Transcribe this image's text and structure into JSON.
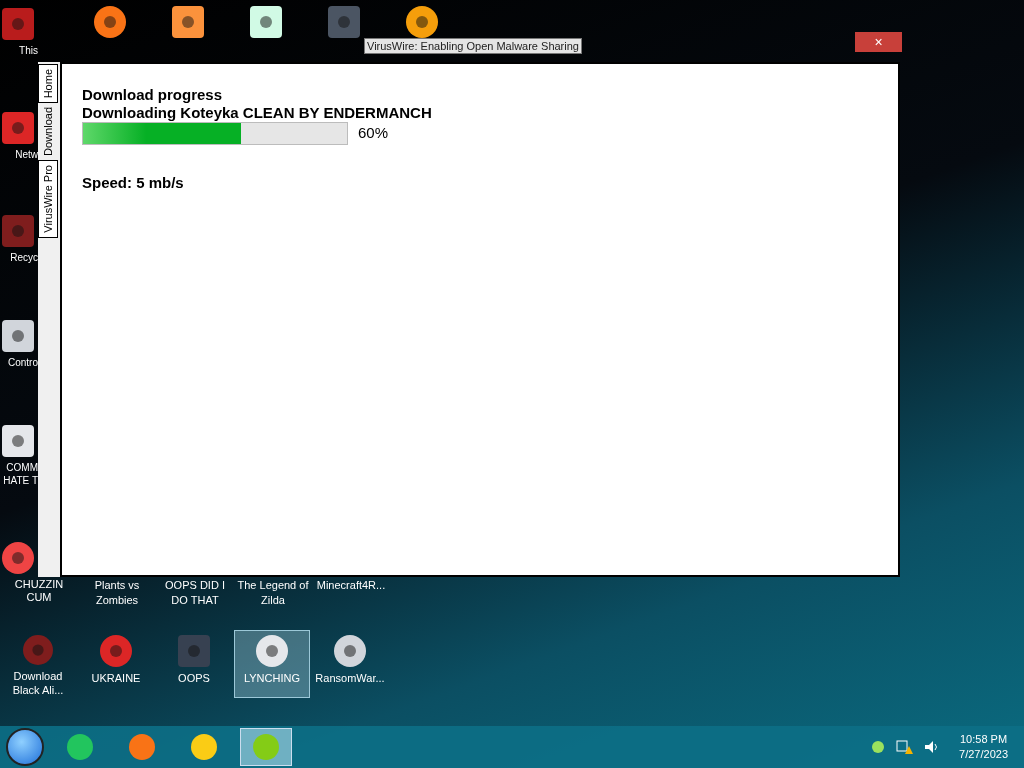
{
  "desktop": {
    "left_column": [
      {
        "label": "This"
      },
      {
        "label": "Netw"
      },
      {
        "label": "Recyc"
      },
      {
        "label": "Contro"
      },
      {
        "label": "COMM HATE T"
      },
      {
        "label": "CHUZZIN CUM"
      }
    ],
    "row_1": [
      {
        "label": "Plants vs Zombies"
      },
      {
        "label": "OOPS DID I DO THAT"
      },
      {
        "label": "The Legend of Zilda"
      },
      {
        "label": "Minecraft4R..."
      }
    ],
    "row_2": [
      {
        "label": "Download Black Ali...",
        "selected": false
      },
      {
        "label": "UKRAINE",
        "selected": false
      },
      {
        "label": "OOPS",
        "selected": false
      },
      {
        "label": "LYNCHING",
        "selected": true
      },
      {
        "label": "RansomWar...",
        "selected": false
      }
    ],
    "tooltip": "VirusWire: Enabling Open Malware Sharing"
  },
  "window": {
    "close": "×",
    "tabs": [
      {
        "label": "Home",
        "selected": false
      },
      {
        "label": "Download",
        "selected": true
      },
      {
        "label": "VirusWire Pro",
        "selected": false
      }
    ],
    "heading": "Download progress",
    "file": "Downloading Koteyka CLEAN BY ENDERMANCH",
    "level": 0.6,
    "percent": "60%",
    "speed": "Speed: 5 mb/s"
  },
  "taskbar": {
    "apps": [
      {
        "selected": false
      },
      {
        "selected": false
      },
      {
        "selected": false
      },
      {
        "selected": true
      }
    ],
    "time": "10:58 PM",
    "date": "7/27/2023"
  }
}
